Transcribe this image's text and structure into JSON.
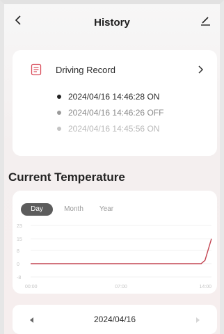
{
  "header": {
    "title": "History"
  },
  "driving_record": {
    "title": "Driving Record",
    "entries": [
      "2024/04/16 14:46:28 ON",
      "2024/04/16 14:46:26 OFF",
      "2024/04/16 14:45:56 ON"
    ]
  },
  "temperature": {
    "section_title": "Current Temperature",
    "tabs": [
      "Day",
      "Month",
      "Year"
    ],
    "active_tab": "Day"
  },
  "chart_data": {
    "type": "line",
    "title": "",
    "xlabel": "",
    "ylabel": "",
    "x_ticks": [
      "00:00",
      "07:00",
      "14:00"
    ],
    "y_ticks": [
      "23",
      "15",
      "8",
      "0",
      "-8"
    ],
    "ylim": [
      -8,
      23
    ],
    "x": [
      0,
      13.2,
      13.5,
      14.0
    ],
    "values": [
      0,
      0,
      2,
      15
    ],
    "line_color": "#c2424f",
    "grid": true
  },
  "date_nav": {
    "date": "2024/04/16"
  }
}
